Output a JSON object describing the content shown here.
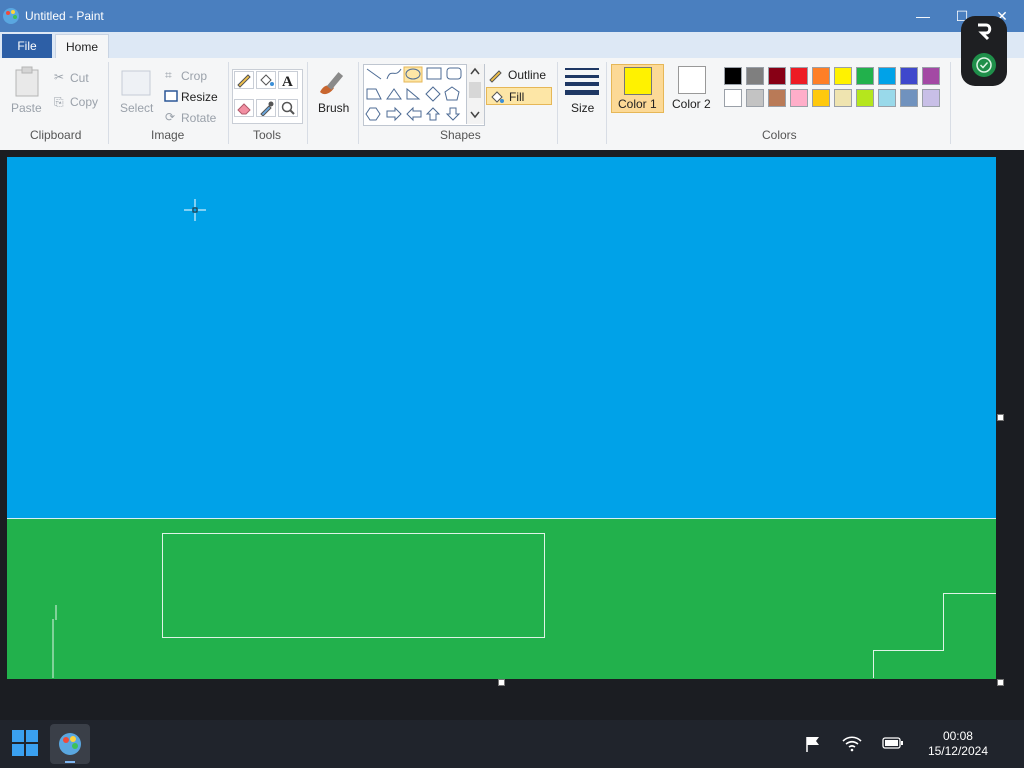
{
  "window": {
    "title": "Untitled - Paint"
  },
  "tabs": {
    "file": "File",
    "home": "Home"
  },
  "clipboard": {
    "paste": "Paste",
    "cut": "Cut",
    "copy": "Copy",
    "label": "Clipboard"
  },
  "image": {
    "select": "Select",
    "crop": "Crop",
    "resize": "Resize",
    "rotate": "Rotate",
    "label": "Image"
  },
  "tools": {
    "label": "Tools"
  },
  "brush": {
    "label": "Brush"
  },
  "shapes": {
    "outline": "Outline",
    "fill": "Fill",
    "label": "Shapes"
  },
  "size": {
    "label": "Size"
  },
  "colors": {
    "color1_label": "Color 1",
    "color2_label": "Color 2",
    "color1_value": "#fff200",
    "color2_value": "#ffffff",
    "label": "Colors",
    "palette_row1": [
      "#000000",
      "#7f7f7f",
      "#880015",
      "#ed1c24",
      "#ff7f27",
      "#fff200",
      "#22b14c",
      "#00a2e8",
      "#3f48cc",
      "#a349a4"
    ],
    "palette_row2": [
      "#ffffff",
      "#c3c3c3",
      "#b97a57",
      "#ffaec9",
      "#ffc90e",
      "#efe4b0",
      "#b5e61d",
      "#99d9ea",
      "#7092be",
      "#c8bfe7"
    ]
  },
  "canvas": {
    "sky_color": "#00a2e8",
    "grass_color": "#22b14c"
  },
  "taskbar": {
    "time": "00:08",
    "date": "15/12/2024"
  }
}
